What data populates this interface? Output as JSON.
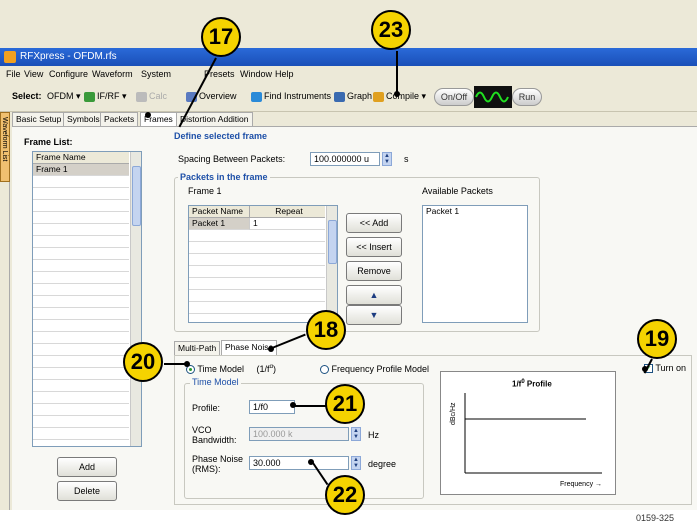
{
  "window": {
    "title": "RFXpress - OFDM.rfs"
  },
  "menu": [
    "File",
    "View",
    "Configure",
    "Waveform",
    "System",
    "Presets",
    "Window",
    "Help"
  ],
  "toolbar": {
    "select_label": "Select:",
    "ofdm": "OFDM ▾",
    "ifrf": "IF/RF ▾",
    "calc": "Calc",
    "overview": "Overview",
    "find": "Find Instruments",
    "graph": "Graph",
    "compile": "Compile",
    "compile_arrow": "▾",
    "onoff": "On/Off",
    "run": "Run"
  },
  "sidebar_tab": "Waveform List",
  "tabs": [
    "Basic Setup",
    "Symbols",
    "Packets",
    "Frames",
    "Distortion Addition"
  ],
  "frame_list": {
    "title": "Frame List:",
    "header": "Frame Name",
    "items": [
      "Frame 1"
    ],
    "add": "Add",
    "delete": "Delete"
  },
  "define": {
    "title": "Define selected frame",
    "spacing_label": "Spacing Between Packets:",
    "spacing_value": "100.000000 u",
    "spacing_unit": "s",
    "packets_title": "Packets in the frame",
    "frame_name": "Frame 1",
    "col_packet": "Packet Name",
    "col_repeat": "Repeat",
    "rows": [
      {
        "name": "Packet 1",
        "repeat": "1"
      }
    ],
    "available_label": "Available Packets",
    "available": [
      "Packet 1"
    ],
    "btn_add": "<< Add",
    "btn_insert": "<< Insert",
    "btn_remove": "Remove",
    "btn_up": "▲",
    "btn_down": "▼"
  },
  "subtabs": [
    "Multi-Path",
    "Phase Noise"
  ],
  "phase": {
    "time_model": "Time Model",
    "time_model_formula": "(1/f",
    "time_model_sup": "α",
    "time_model_close": ")",
    "freq_model": "Frequency Profile Model",
    "turn_on": "Turn on",
    "group_title": "Time Model",
    "profile_label": "Profile:",
    "profile_value": "1/f0",
    "vco_label": "VCO Bandwidth:",
    "vco_value": "100.000 k",
    "vco_unit": "Hz",
    "noise_label": "Phase Noise (RMS):",
    "noise_value": "30.000",
    "noise_unit": "degree",
    "graph_title": "1/f",
    "graph_title_sup": "0",
    "graph_title_rest": " Profile",
    "graph_ylabel": "dBc/Hz",
    "graph_xlabel": "Frequency →"
  },
  "callouts": {
    "c17": "17",
    "c23": "23",
    "c18": "18",
    "c19": "19",
    "c20": "20",
    "c21": "21",
    "c22": "22"
  },
  "figure_id": "0159-325"
}
